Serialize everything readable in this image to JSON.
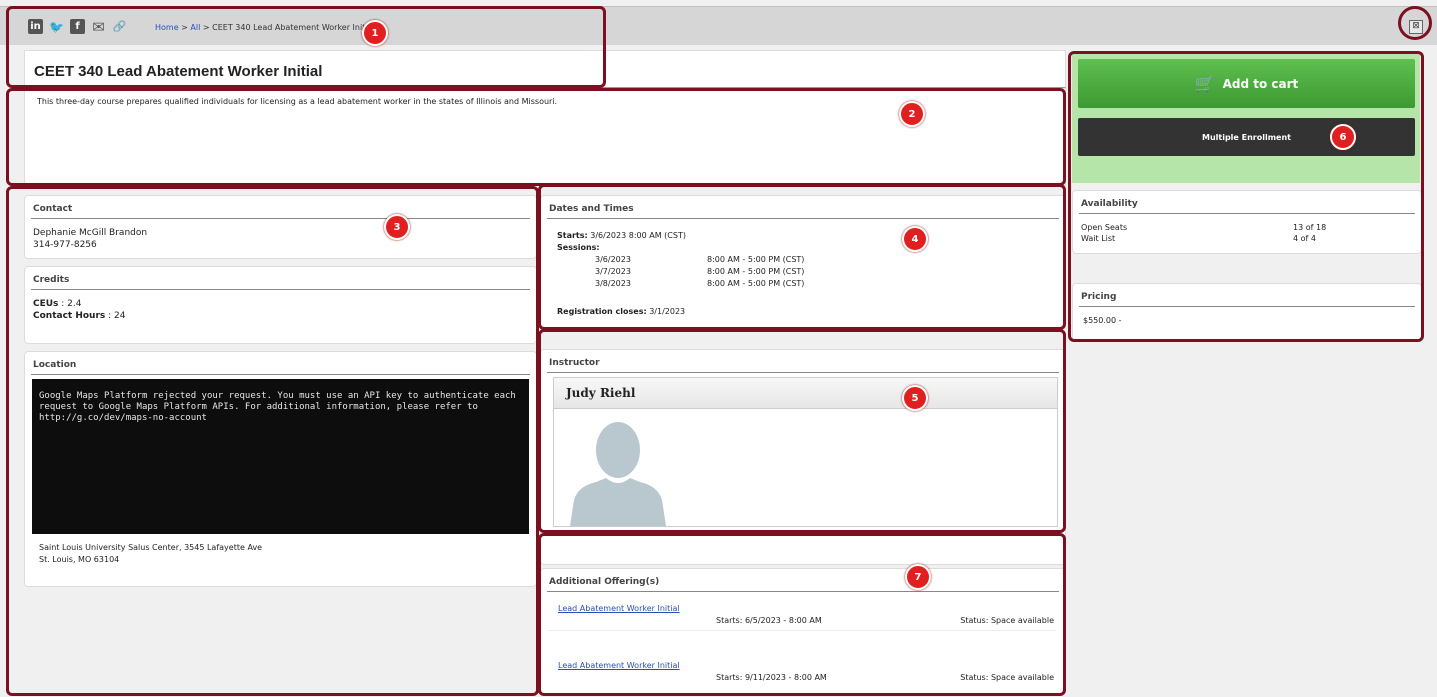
{
  "breadcrumb": {
    "home": "Home",
    "sep1": " > ",
    "all": "All",
    "sep2": " > ",
    "current": "CEET 340  Lead Abatement Worker Initial"
  },
  "share_icons": [
    "linkedin-icon",
    "twitter-icon",
    "facebook-icon",
    "email-icon",
    "link-icon"
  ],
  "share_glyphs": {
    "linkedin": "in",
    "twitter": "🐦",
    "facebook": "f",
    "email": "✉",
    "link": "🔗"
  },
  "close_glyph": "⊠",
  "course": {
    "title": "CEET 340  Lead Abatement Worker Initial",
    "description": "This three-day course prepares qualified individuals for licensing as a lead abatement worker in the states of Illinois and Missouri."
  },
  "contact": {
    "heading": "Contact",
    "name": "Dephanie McGill Brandon",
    "phone": "314-977-8256"
  },
  "credits": {
    "heading": "Credits",
    "ceu_label": "CEUs",
    "ceu_value": " : 2.4",
    "hours_label": "Contact Hours",
    "hours_value": " : 24"
  },
  "location": {
    "heading": "Location",
    "map_error": "Google Maps Platform rejected your request. You must use an API key to authenticate each request to Google Maps Platform APIs. For additional information, please refer to http://g.co/dev/maps-no-account",
    "address1": "Saint Louis University Salus Center, 3545 Lafayette Ave",
    "address2": "St. Louis, MO 63104"
  },
  "dates": {
    "heading": "Dates and Times",
    "starts_label": "Starts:",
    "starts_value": "3/6/2023   8:00 AM (CST)",
    "sessions_label": "Sessions:",
    "sessions": [
      {
        "date": "3/6/2023",
        "time": "8:00 AM - 5:00 PM  (CST)"
      },
      {
        "date": "3/7/2023",
        "time": "8:00 AM - 5:00 PM  (CST)"
      },
      {
        "date": "3/8/2023",
        "time": "8:00 AM - 5:00 PM  (CST)"
      }
    ],
    "reg_label": "Registration closes:",
    "reg_value": "3/1/2023"
  },
  "instructor": {
    "heading": "Instructor",
    "name": "Judy  Riehl"
  },
  "offerings": {
    "heading": "Additional Offering(s)",
    "items": [
      {
        "link": "Lead Abatement Worker Initial",
        "starts": "Starts: 6/5/2023 - 8:00 AM",
        "status": "Status: Space available"
      },
      {
        "link": "Lead Abatement Worker Initial",
        "starts": "Starts: 9/11/2023 - 8:00 AM",
        "status": "Status: Space available"
      }
    ]
  },
  "cart": {
    "add_label": "Add to cart",
    "multi_label": "Multiple Enrollment",
    "cart_glyph": "🛒"
  },
  "availability": {
    "heading": "Availability",
    "open_label": "Open Seats",
    "open_value": "13 of 18",
    "wait_label": "Wait List",
    "wait_value": "4 of 4"
  },
  "pricing": {
    "heading": "Pricing",
    "value": "$550.00 -"
  },
  "badges": [
    "1",
    "2",
    "3",
    "4",
    "5",
    "6",
    "7"
  ],
  "colors": {
    "accent_green": "#4caf3f",
    "highlight": "#7a1020",
    "badge_red": "#e02020"
  }
}
